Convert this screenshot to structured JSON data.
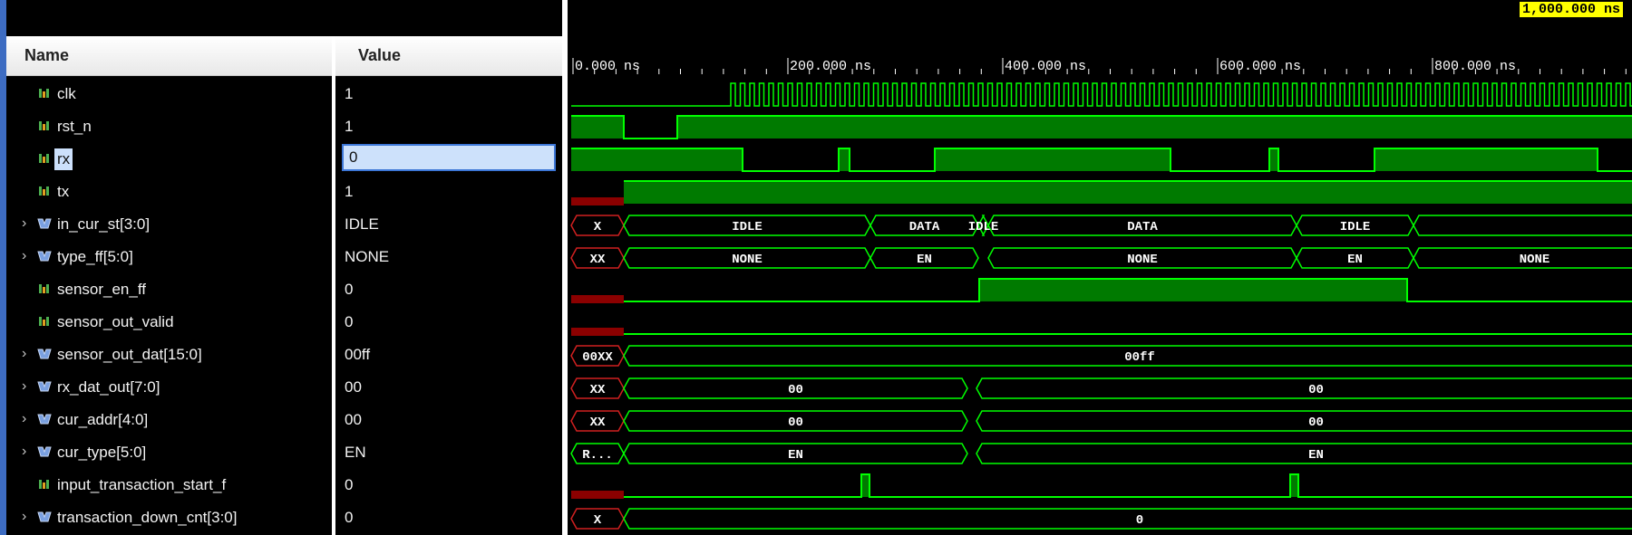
{
  "columns": {
    "name": "Name",
    "value": "Value"
  },
  "cursor_marker": "1,000.000 ns",
  "time_ticks": [
    "0.000 ns",
    "200.000 ns",
    "400.000 ns",
    "600.000 ns",
    "800.000 ns"
  ],
  "signals": [
    {
      "name": "clk",
      "value": "1",
      "kind": "bit",
      "expandable": false
    },
    {
      "name": "rst_n",
      "value": "1",
      "kind": "bit",
      "expandable": false
    },
    {
      "name": "rx",
      "value": "0",
      "kind": "bit",
      "expandable": false,
      "selected": true
    },
    {
      "name": "tx",
      "value": "1",
      "kind": "bit",
      "expandable": false
    },
    {
      "name": "in_cur_st[3:0]",
      "value": "IDLE",
      "kind": "bus",
      "expandable": true
    },
    {
      "name": "type_ff[5:0]",
      "value": "NONE",
      "kind": "bus",
      "expandable": true
    },
    {
      "name": "sensor_en_ff",
      "value": "0",
      "kind": "bit",
      "expandable": false
    },
    {
      "name": "sensor_out_valid",
      "value": "0",
      "kind": "bit",
      "expandable": false
    },
    {
      "name": "sensor_out_dat[15:0]",
      "value": "00ff",
      "kind": "bus",
      "expandable": true
    },
    {
      "name": "rx_dat_out[7:0]",
      "value": "00",
      "kind": "bus",
      "expandable": true
    },
    {
      "name": "cur_addr[4:0]",
      "value": "00",
      "kind": "bus",
      "expandable": true
    },
    {
      "name": "cur_type[5:0]",
      "value": "EN",
      "kind": "bus",
      "expandable": true
    },
    {
      "name": "input_transaction_start_f",
      "value": "0",
      "kind": "bit",
      "expandable": false
    },
    {
      "name": "transaction_down_cnt[3:0]",
      "value": "0",
      "kind": "bus",
      "expandable": true
    }
  ],
  "bus_labels": {
    "in_cur_st": [
      "X",
      "IDLE",
      "DATA",
      "IDLE",
      "DATA",
      "IDLE"
    ],
    "type_ff": [
      "XX",
      "NONE",
      "EN",
      "NONE",
      "EN",
      "NONE"
    ],
    "sensor_out_dat": [
      "00XX",
      "00ff"
    ],
    "rx_dat_out": [
      "XX",
      "00",
      "00"
    ],
    "cur_addr": [
      "XX",
      "00",
      "00"
    ],
    "cur_type": [
      "R...",
      "EN",
      "EN"
    ],
    "transaction_down_cnt": [
      "X",
      "0"
    ]
  },
  "colors": {
    "waveform": "#00ff00",
    "waveform_fill": "#007a00",
    "undefined": "#8b0000",
    "marker": "#ffff00",
    "selection": "#cce0fb"
  }
}
